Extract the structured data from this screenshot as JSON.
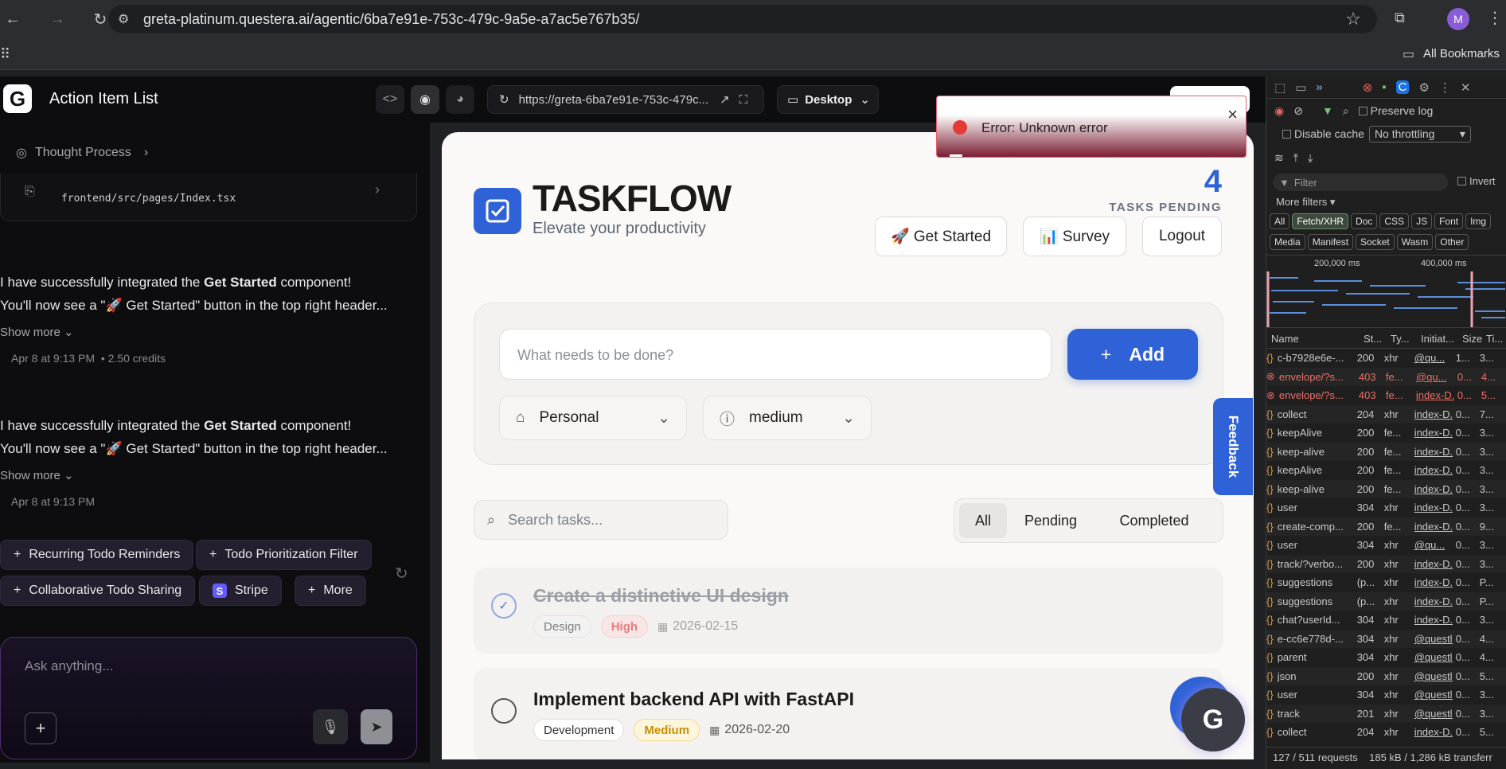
{
  "browser": {
    "url": "greta-platinum.questera.ai/agentic/6ba7e91e-753c-479c-9a5e-a7ac5e767b35/",
    "profile_initial": "M",
    "bookmarks_label": "All Bookmarks"
  },
  "app_header": {
    "title": "Action Item List",
    "preview_url": "https://greta-6ba7e91e-753c-479c...",
    "device_label": "Desktop"
  },
  "left_panel": {
    "thought_process_label": "Thought Process",
    "file_path": "frontend/src/pages/Index.tsx",
    "messages": [
      {
        "line1_pre": "I have successfully integrated the ",
        "line1_bold": "Get Started",
        "line1_post": " component!",
        "line2": "You'll now see a \"🚀 Get Started\" button in the top right header...",
        "show_more": "Show more",
        "meta": "Apr 8 at 9:13 PM",
        "credits": "• 2.50 credits"
      },
      {
        "line1_pre": "I have successfully integrated the ",
        "line1_bold": "Get Started",
        "line1_post": " component!",
        "line2": "You'll now see a \"🚀 Get Started\" button in the top right header...",
        "show_more": "Show more",
        "meta": "Apr 8 at 9:13 PM",
        "credits": ""
      }
    ],
    "suggestions": [
      "Recurring Todo Reminders",
      "Todo Prioritization Filter",
      "Collaborative Todo Sharing",
      "Stripe",
      "More"
    ],
    "chat_placeholder": "Ask anything..."
  },
  "toast": {
    "message": "Error: Unknown error",
    "close": "×"
  },
  "taskflow": {
    "brand": "TASKFLOW",
    "tagline": "Elevate your productivity",
    "pending_count": "4",
    "pending_label": "TASKS PENDING",
    "header_buttons": {
      "get_started": "🚀 Get Started",
      "survey": "📊 Survey",
      "logout": "Logout"
    },
    "input_placeholder": "What needs to be done?",
    "add_label": "Add",
    "category": "Personal",
    "priority": "medium",
    "search_placeholder": "Search tasks...",
    "filters": [
      "All",
      "Pending",
      "Completed"
    ],
    "tasks": [
      {
        "title": "Create a distinctive UI design",
        "category": "Design",
        "priority": "High",
        "date": "2026-02-15",
        "completed": true
      },
      {
        "title": "Implement backend API with FastAPI",
        "category": "Development",
        "priority": "Medium",
        "date": "2026-02-20",
        "completed": false
      }
    ],
    "feedback_label": "Feedback"
  },
  "devtools": {
    "preserve_log": "Preserve log",
    "disable_cache": "Disable cache",
    "throttling": "No throttling",
    "filter_placeholder": "Filter",
    "invert": "Invert",
    "more_filters": "More filters",
    "type_filters": [
      "All",
      "Fetch/XHR",
      "Doc",
      "CSS",
      "JS",
      "Font",
      "Img",
      "Media",
      "Manifest",
      "Socket",
      "Wasm",
      "Other"
    ],
    "timeline_labels": [
      "200,000 ms",
      "400,000 ms"
    ],
    "columns": [
      "Name",
      "St...",
      "Ty...",
      "Initiat...",
      "Size",
      "Ti..."
    ],
    "rows": [
      {
        "name": "c-b7928e6e-...",
        "status": "200",
        "type": "xhr",
        "initiator": "@qu...",
        "size": "1...",
        "time": "3...",
        "error": false
      },
      {
        "name": "envelope/?s...",
        "status": "403",
        "type": "fe...",
        "initiator": "@qu...",
        "size": "0...",
        "time": "4...",
        "error": true
      },
      {
        "name": "envelope/?s...",
        "status": "403",
        "type": "fe...",
        "initiator": "index-D...",
        "size": "0...",
        "time": "5...",
        "error": true
      },
      {
        "name": "collect",
        "status": "204",
        "type": "xhr",
        "initiator": "index-D...",
        "size": "0...",
        "time": "7...",
        "error": false
      },
      {
        "name": "keepAlive",
        "status": "200",
        "type": "fe...",
        "initiator": "index-D...",
        "size": "0...",
        "time": "3...",
        "error": false
      },
      {
        "name": "keep-alive",
        "status": "200",
        "type": "fe...",
        "initiator": "index-D...",
        "size": "0...",
        "time": "3...",
        "error": false
      },
      {
        "name": "keepAlive",
        "status": "200",
        "type": "fe...",
        "initiator": "index-D...",
        "size": "0...",
        "time": "3...",
        "error": false
      },
      {
        "name": "keep-alive",
        "status": "200",
        "type": "fe...",
        "initiator": "index-D...",
        "size": "0...",
        "time": "3...",
        "error": false
      },
      {
        "name": "user",
        "status": "304",
        "type": "xhr",
        "initiator": "index-D...",
        "size": "0...",
        "time": "3...",
        "error": false
      },
      {
        "name": "create-comp...",
        "status": "200",
        "type": "fe...",
        "initiator": "index-D...",
        "size": "0...",
        "time": "9...",
        "error": false
      },
      {
        "name": "user",
        "status": "304",
        "type": "xhr",
        "initiator": "@qu...",
        "size": "0...",
        "time": "3...",
        "error": false
      },
      {
        "name": "track/?verbo...",
        "status": "200",
        "type": "xhr",
        "initiator": "index-D...",
        "size": "0...",
        "time": "3...",
        "error": false
      },
      {
        "name": "suggestions",
        "status": "(p...",
        "type": "xhr",
        "initiator": "index-D...",
        "size": "0...",
        "time": "P...",
        "error": false
      },
      {
        "name": "suggestions",
        "status": "(p...",
        "type": "xhr",
        "initiator": "index-D...",
        "size": "0...",
        "time": "P...",
        "error": false
      },
      {
        "name": "chat?userId...",
        "status": "304",
        "type": "xhr",
        "initiator": "index-D...",
        "size": "0...",
        "time": "3...",
        "error": false
      },
      {
        "name": "e-cc6e778d-...",
        "status": "304",
        "type": "xhr",
        "initiator": "@questl...",
        "size": "0...",
        "time": "4...",
        "error": false
      },
      {
        "name": "parent",
        "status": "304",
        "type": "xhr",
        "initiator": "@questl...",
        "size": "0...",
        "time": "4...",
        "error": false
      },
      {
        "name": "json",
        "status": "200",
        "type": "xhr",
        "initiator": "@questl...",
        "size": "0...",
        "time": "5...",
        "error": false
      },
      {
        "name": "user",
        "status": "304",
        "type": "xhr",
        "initiator": "@questl...",
        "size": "0...",
        "time": "3...",
        "error": false
      },
      {
        "name": "track",
        "status": "201",
        "type": "xhr",
        "initiator": "@questl...",
        "size": "0...",
        "time": "3...",
        "error": false
      },
      {
        "name": "collect",
        "status": "204",
        "type": "xhr",
        "initiator": "index-D...",
        "size": "0...",
        "time": "5...",
        "error": false
      }
    ],
    "status_bar": "127 / 511 requests    185 kB / 1,286 kB transferr"
  },
  "colors": {
    "accent": "#2f62d6",
    "error": "#e53935",
    "brand_dark": "#1a1a1a"
  }
}
